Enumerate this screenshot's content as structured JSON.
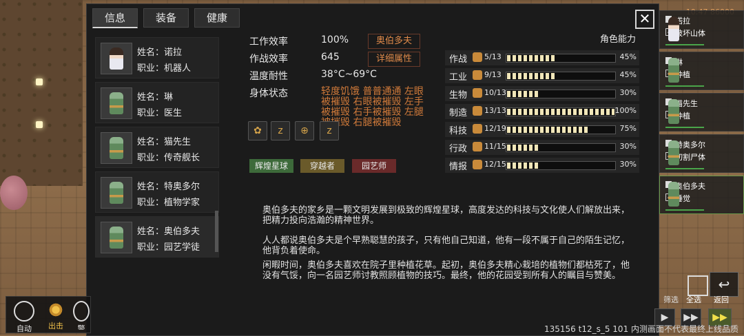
{
  "tabs": [
    "信息",
    "装备",
    "健康"
  ],
  "roster": [
    {
      "name": "姓名：诺拉",
      "job": "职业：机器人",
      "avatar": "girl"
    },
    {
      "name": "姓名：琳",
      "job": "职业：医生",
      "avatar": "robot"
    },
    {
      "name": "姓名：猫先生",
      "job": "职业：传奇舰长",
      "avatar": "robot"
    },
    {
      "name": "姓名：特奥多尔",
      "job": "职业：植物学家",
      "avatar": "robot"
    },
    {
      "name": "姓名：奥伯多夫",
      "job": "职业：园艺学徒",
      "avatar": "robot"
    }
  ],
  "stats": {
    "work_label": "工作效率",
    "work_value": "100%",
    "combat_label": "作战效率",
    "combat_value": "645",
    "temp_label": "温度耐性",
    "temp_value": "38°C~69°C",
    "body_label": "身体状态",
    "body_status": "轻度饥饿 普普通通 左眼被摧毁 右眼被摧毁 左手被摧毁 右手被摧毁 左腿被摧毁 右腿被摧毁",
    "name_button": "奥伯多夫",
    "detail_button": "详细属性"
  },
  "status_icons": [
    "seedling-icon",
    "sleep-icon",
    "target-icon",
    "sleep-icon"
  ],
  "traits": [
    {
      "label": "辉煌星球",
      "color": "#3d6a3a"
    },
    {
      "label": "穿越者",
      "color": "#6a5a2a"
    },
    {
      "label": "园艺师",
      "color": "#6a2a2a"
    }
  ],
  "abilities_title": "角色能力",
  "abilities": [
    {
      "name": "作战",
      "level": "5/13",
      "value": 45,
      "pct": "45%"
    },
    {
      "name": "工业",
      "level": "9/13",
      "value": 45,
      "pct": "45%"
    },
    {
      "name": "生物",
      "level": "10/13",
      "value": 30,
      "pct": "30%"
    },
    {
      "name": "制造",
      "level": "13/13",
      "value": 100,
      "pct": "100%"
    },
    {
      "name": "科技",
      "level": "12/19",
      "value": 75,
      "pct": "75%"
    },
    {
      "name": "行政",
      "level": "11/15",
      "value": 30,
      "pct": "30%"
    },
    {
      "name": "情报",
      "level": "12/15",
      "value": 30,
      "pct": "30%"
    }
  ],
  "bio": [
    "奥伯多夫的家乡是一颗文明发展到极致的辉煌星球，高度发达的科技与文化使人们解放出来，把精力投向浩瀚的精神世界。",
    "人人都说奥伯多夫是个早熟聪慧的孩子，只有他自己知道，他有一段不属于自己的陌生记忆，他背负着使命。",
    "闲暇时间，奥伯多夫喜欢在院子里种植花草。起初，奥伯多夫精心栽培的植物们都枯死了，他没有气馁，向一名园艺师讨教照顾植物的技巧。最终，他的花园受到所有人的瞩目与赞美。"
  ],
  "colonists": [
    {
      "name": "诺拉",
      "task": "破坏山体",
      "sprite": "girl"
    },
    {
      "name": "琳",
      "task": "种植",
      "sprite": "robot"
    },
    {
      "name": "猫先生",
      "task": "种植",
      "sprite": "robot"
    },
    {
      "name": "特奥多尔",
      "task": "切割尸体",
      "sprite": "robot"
    },
    {
      "name": "奥伯多夫",
      "task": "睡觉",
      "sprite": "robot"
    }
  ],
  "clock": "10:47 86000",
  "toolbar": {
    "auto": "自动",
    "attack": "出击",
    "alert": "警"
  },
  "bottom": {
    "filter": "筛选",
    "select_all": "全选",
    "back": "返回"
  },
  "watermark": "135156 t12_s_5 101 内测画面不代表最终上线品质"
}
